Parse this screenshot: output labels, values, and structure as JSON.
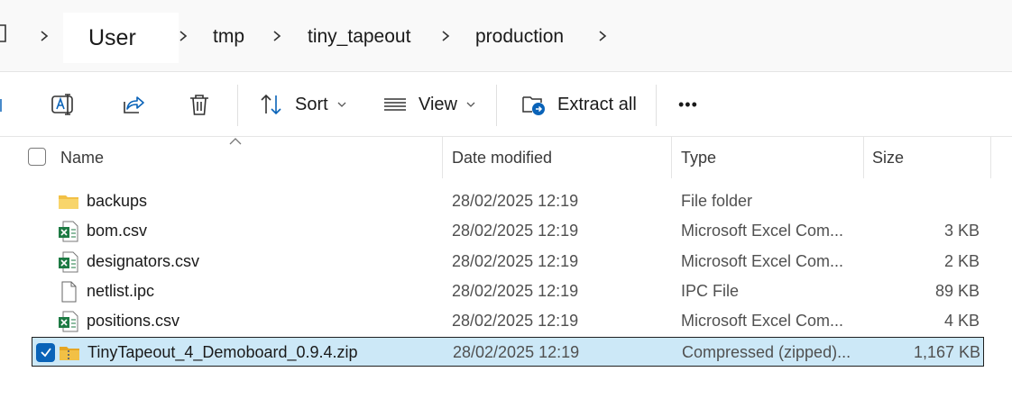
{
  "breadcrumb": {
    "items": [
      "User",
      "tmp",
      "tiny_tapeout",
      "production"
    ]
  },
  "toolbar": {
    "sort_label": "Sort",
    "view_label": "View",
    "extract_label": "Extract all",
    "more_label": "•••"
  },
  "columns": {
    "name": "Name",
    "date": "Date modified",
    "type": "Type",
    "size": "Size"
  },
  "files": [
    {
      "name": "backups",
      "icon": "folder-icon",
      "date": "28/02/2025 12:19",
      "type": "File folder",
      "size": ""
    },
    {
      "name": "bom.csv",
      "icon": "excel-file-icon",
      "date": "28/02/2025 12:19",
      "type": "Microsoft Excel Com...",
      "size": "3 KB"
    },
    {
      "name": "designators.csv",
      "icon": "excel-file-icon",
      "date": "28/02/2025 12:19",
      "type": "Microsoft Excel Com...",
      "size": "2 KB"
    },
    {
      "name": "netlist.ipc",
      "icon": "blank-file-icon",
      "date": "28/02/2025 12:19",
      "type": "IPC File",
      "size": "89 KB"
    },
    {
      "name": "positions.csv",
      "icon": "excel-file-icon",
      "date": "28/02/2025 12:19",
      "type": "Microsoft Excel Com...",
      "size": "4 KB"
    },
    {
      "name": "TinyTapeout_4_Demoboard_0.9.4.zip",
      "icon": "zip-folder-icon",
      "date": "28/02/2025 12:19",
      "type": "Compressed (zipped)...",
      "size": "1,167 KB",
      "selected": true
    }
  ],
  "colors": {
    "accent": "#0a63b8",
    "selection_bg": "#cce8f7",
    "folder": "#f2c045",
    "excel": "#1d7a43"
  }
}
